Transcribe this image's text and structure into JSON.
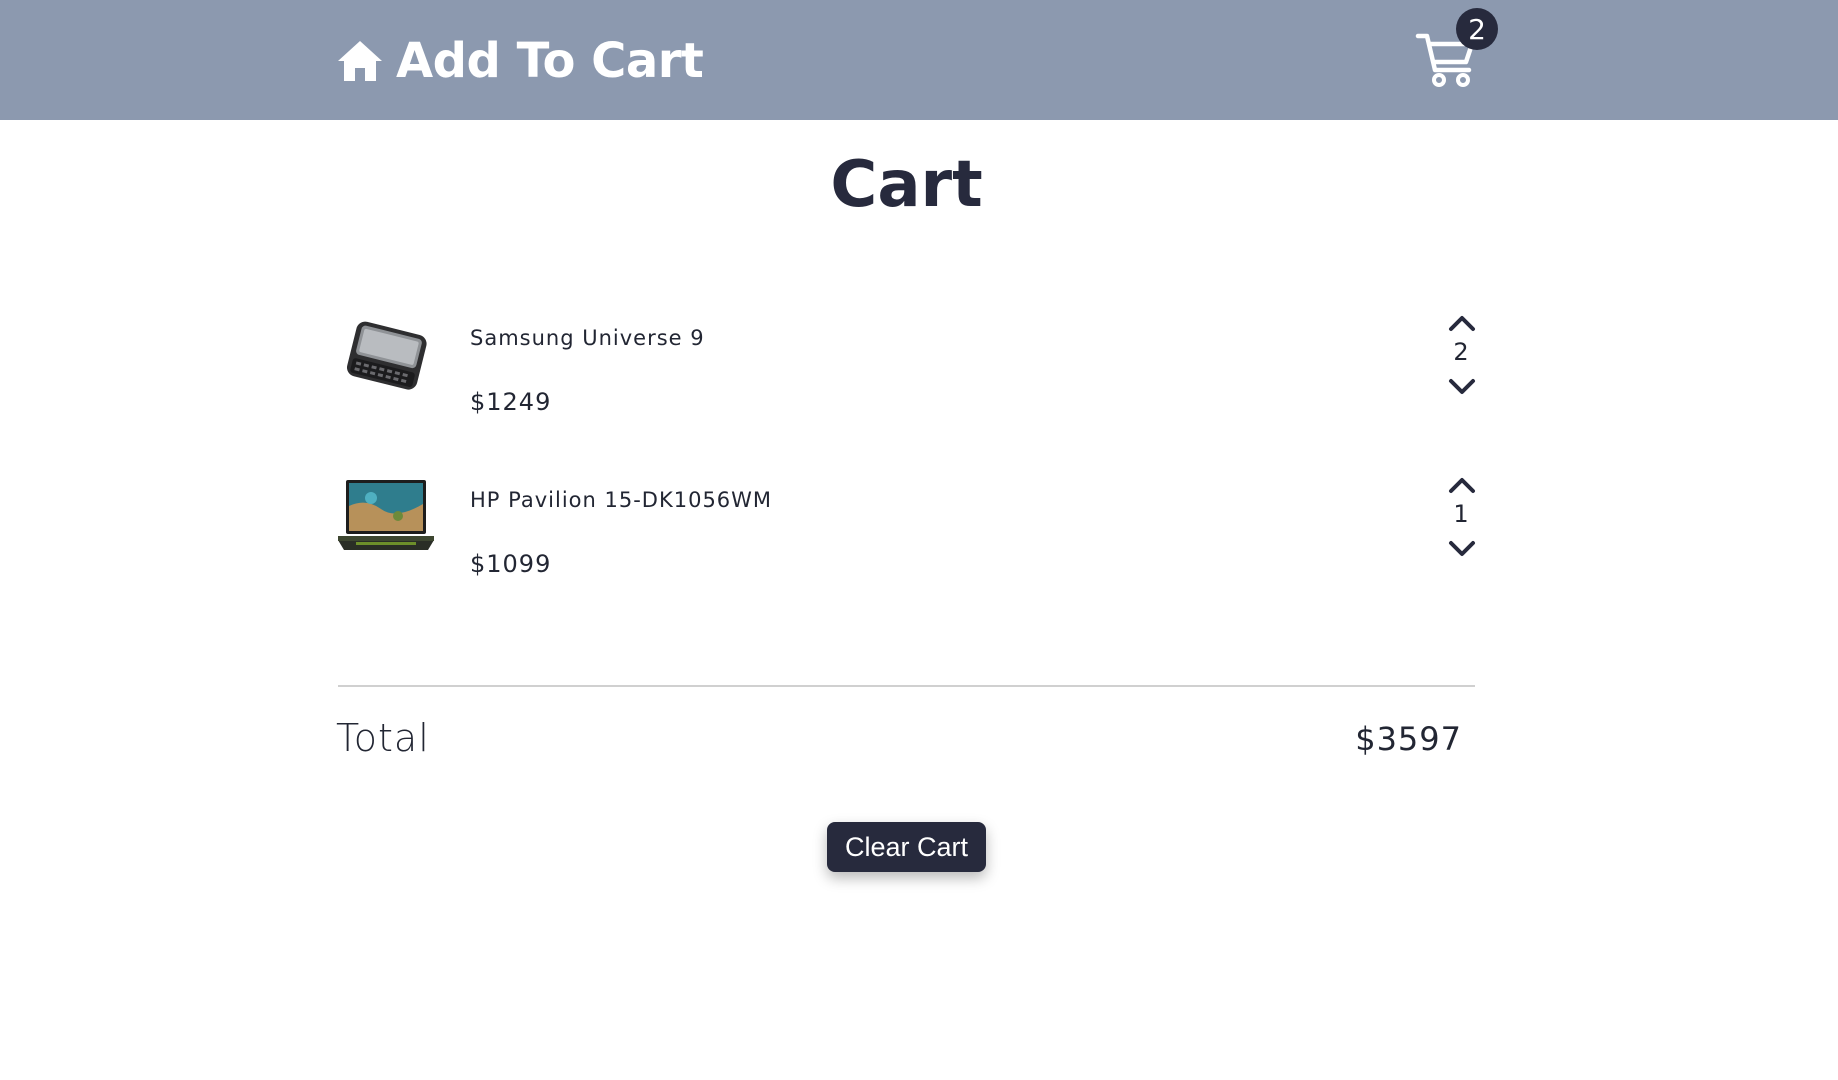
{
  "header": {
    "brand_icon": "home-icon",
    "title": "Add To Cart",
    "cart_icon": "cart-icon",
    "cart_count": "2",
    "background": "#8c99af"
  },
  "page": {
    "title": "Cart"
  },
  "cart": {
    "items": [
      {
        "name": "Samsung Universe 9",
        "price": "$1249",
        "quantity": "2",
        "image": "phone-image"
      },
      {
        "name": "HP Pavilion 15-DK1056WM",
        "price": "$1099",
        "quantity": "1",
        "image": "laptop-image"
      }
    ],
    "total_label": "Total",
    "total_value": "$3597",
    "clear_label": "Clear Cart"
  },
  "colors": {
    "accent_dark": "#272a3d",
    "navbar": "#8c99af"
  }
}
